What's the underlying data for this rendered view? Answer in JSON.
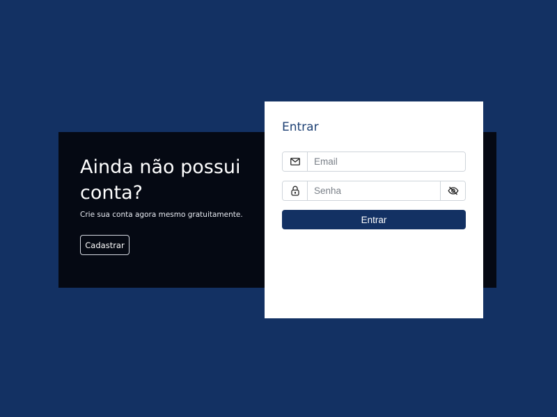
{
  "colors": {
    "background": "#133163",
    "dark_panel": "#050913",
    "card": "#ffffff",
    "primary": "#133163",
    "title": "#1c3f73"
  },
  "signup": {
    "heading": "Ainda não possui conta?",
    "subtext": "Crie sua conta agora mesmo gratuitamente.",
    "button_label": "Cadastrar"
  },
  "login": {
    "title": "Entrar",
    "email": {
      "icon": "envelope-icon",
      "placeholder": "Email",
      "value": ""
    },
    "password": {
      "icon": "lock-icon",
      "placeholder": "Senha",
      "value": "",
      "toggle_icon": "eye-slash-icon"
    },
    "submit_label": "Entrar"
  }
}
